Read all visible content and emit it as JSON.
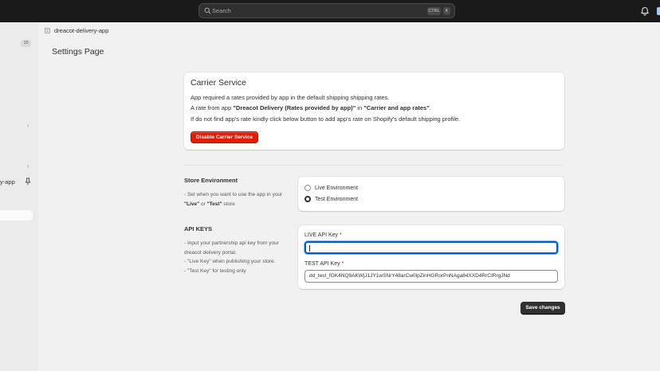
{
  "topbar": {
    "search_placeholder": "Search",
    "shortcut_ctrl": "CTRL",
    "shortcut_key": "K"
  },
  "sidebar": {
    "badge": "10",
    "app_label": "y-app"
  },
  "breadcrumb": {
    "app_name": "dreacot-delivery-app"
  },
  "page": {
    "title": "Settings Page"
  },
  "carrier": {
    "title": "Carrier Service",
    "line1": "App required a rates provided by app in the default shipping shipping rates.",
    "line2_prefix": "A rate from app ",
    "line2_bold1": "\"Dreacot Delivery (Rates provided by app)\"",
    "line2_mid": " in ",
    "line2_bold2": "\"Carrier and app rates\"",
    "line2_suffix": ".",
    "line3": "If do not find app's rate kindly click below button to add app's rate on Shopify's default shipping profile.",
    "button_label": "Disable Carrier Service"
  },
  "environment": {
    "title": "Store Environment",
    "desc1": "- Set when you want to use the app in your",
    "desc2_b1": "\"Live\"",
    "desc2_mid": " or ",
    "desc2_b2": "\"Test\"",
    "desc2_suffix": " store",
    "options": [
      {
        "label": "Live Environment",
        "selected": false
      },
      {
        "label": "Test Environment",
        "selected": true
      }
    ]
  },
  "api_keys": {
    "title": "API KEYS",
    "desc_lines": [
      "- Input your partnership api key from your",
      "dreacot delivery portal.",
      "- \"Live Key\" when publishing your store.",
      "- \"Test Key\" for testing only"
    ],
    "live_label": "LIVE API Key",
    "live_value": "",
    "test_label": "TEST API Key",
    "test_value": "dd_test_fGK4NQ9AKWjJ1JY1wSNrY48arCw0lpZinHGRorPnNAga84XXD4RrCIRrgJNd",
    "required_mark": "*"
  },
  "actions": {
    "save_label": "Save changes"
  },
  "colors": {
    "critical": "#e51c00",
    "focus": "#005bd3",
    "primary": "#303030"
  }
}
